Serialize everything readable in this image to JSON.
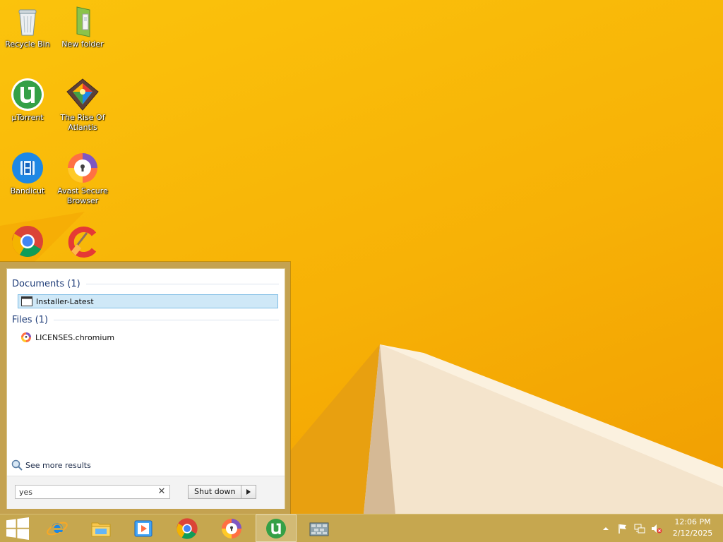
{
  "desktop": {
    "icons": [
      {
        "label": "Recycle Bin",
        "icon": "recycle-bin-icon"
      },
      {
        "label": "New folder",
        "icon": "folder-icon"
      },
      {
        "label": "µTorrent",
        "icon": "utorrent-icon"
      },
      {
        "label": "The Rise Of Atlantis",
        "icon": "rise-of-atlantis-icon"
      },
      {
        "label": "Bandicut",
        "icon": "bandicut-icon"
      },
      {
        "label": "Avast Secure Browser",
        "icon": "avast-secure-browser-icon"
      },
      {
        "label": "",
        "icon": "chrome-icon"
      },
      {
        "label": "",
        "icon": "ccleaner-icon"
      }
    ]
  },
  "start_menu": {
    "groups": [
      {
        "title": "Documents (1)",
        "items": [
          {
            "label": "Installer-Latest",
            "icon": "window-app-icon",
            "selected": true
          }
        ]
      },
      {
        "title": "Files (1)",
        "items": [
          {
            "label": "LICENSES.chromium",
            "icon": "avast-browser-file-icon",
            "selected": false
          }
        ]
      }
    ],
    "see_more_label": "See more results",
    "search": {
      "value": "yes",
      "clear_glyph": "✕"
    },
    "shutdown_label": "Shut down"
  },
  "taskbar": {
    "pinned": [
      {
        "name": "internet-explorer-icon",
        "active": false
      },
      {
        "name": "file-explorer-icon",
        "active": false
      },
      {
        "name": "media-player-icon",
        "active": false
      },
      {
        "name": "chrome-icon",
        "active": false
      },
      {
        "name": "avast-secure-browser-icon",
        "active": false
      },
      {
        "name": "utorrent-icon",
        "active": true
      },
      {
        "name": "game-launcher-icon",
        "active": false
      }
    ],
    "tray": [
      "show-hidden-icons-icon",
      "action-center-flag-icon",
      "network-icon",
      "volume-muted-icon"
    ],
    "time": "12:06 PM",
    "date": "2/12/2025"
  },
  "colors": {
    "accent": "#c6a74f",
    "wallpaper": "#f7b106",
    "selection": "#cfe8f7"
  }
}
